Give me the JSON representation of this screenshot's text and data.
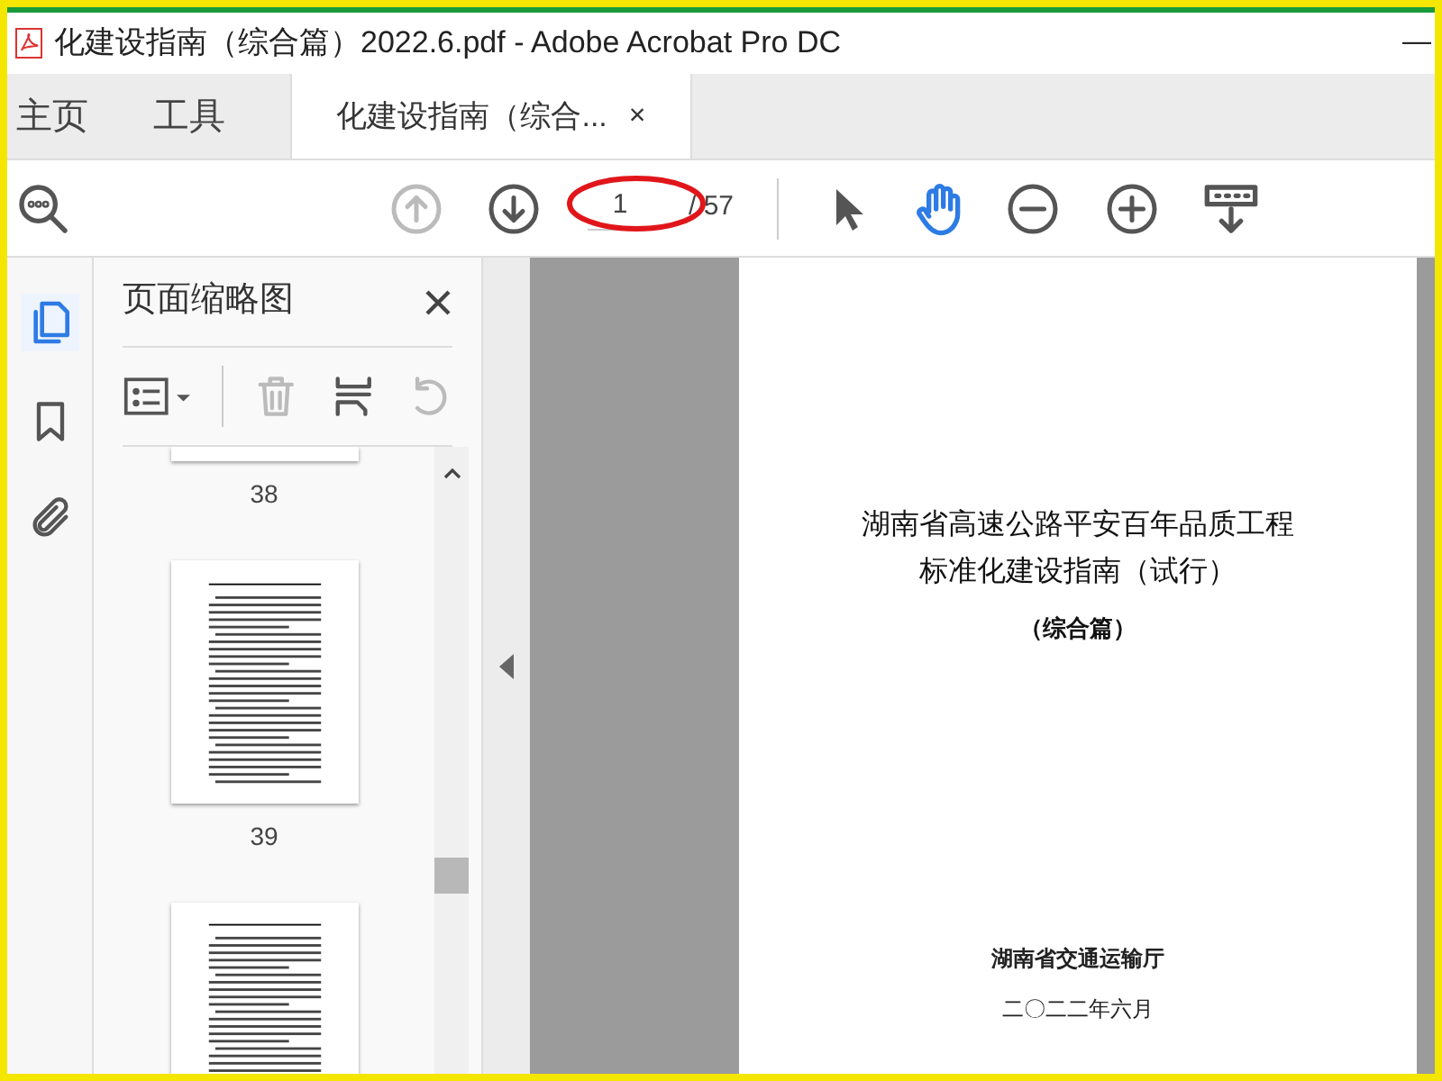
{
  "window": {
    "title": "化建设指南（综合篇）2022.6.pdf - Adobe Acrobat Pro DC",
    "control": "—"
  },
  "tabs": [
    {
      "label": "主页",
      "selected": false,
      "kind": "nav"
    },
    {
      "label": "工具",
      "selected": false,
      "kind": "nav"
    },
    {
      "label": "化建设指南（综合...",
      "selected": true,
      "kind": "doc",
      "close": "×"
    }
  ],
  "toolbar": {
    "page_current": "1",
    "page_total": "/ 57",
    "prev_disabled": true,
    "hand_active": true
  },
  "sidebar": {
    "items": [
      {
        "kind": "pages",
        "selected": true
      },
      {
        "kind": "bookmarks",
        "selected": false
      },
      {
        "kind": "attachments",
        "selected": false
      }
    ]
  },
  "thumbnails_panel": {
    "title": "页面缩略图",
    "delete_disabled": true,
    "undo_disabled": true,
    "pages": [
      {
        "label": "38",
        "kind": "partial"
      },
      {
        "label": "39",
        "kind": "full"
      },
      {
        "kind": "cut"
      }
    ]
  },
  "document": {
    "title_lines": [
      "湖南省高速公路平安百年品质工程",
      "标准化建设指南（试行）"
    ],
    "subtitle": "（综合篇）",
    "issuer": "湖南省交通运输厅",
    "date": "二〇二二年六月"
  }
}
